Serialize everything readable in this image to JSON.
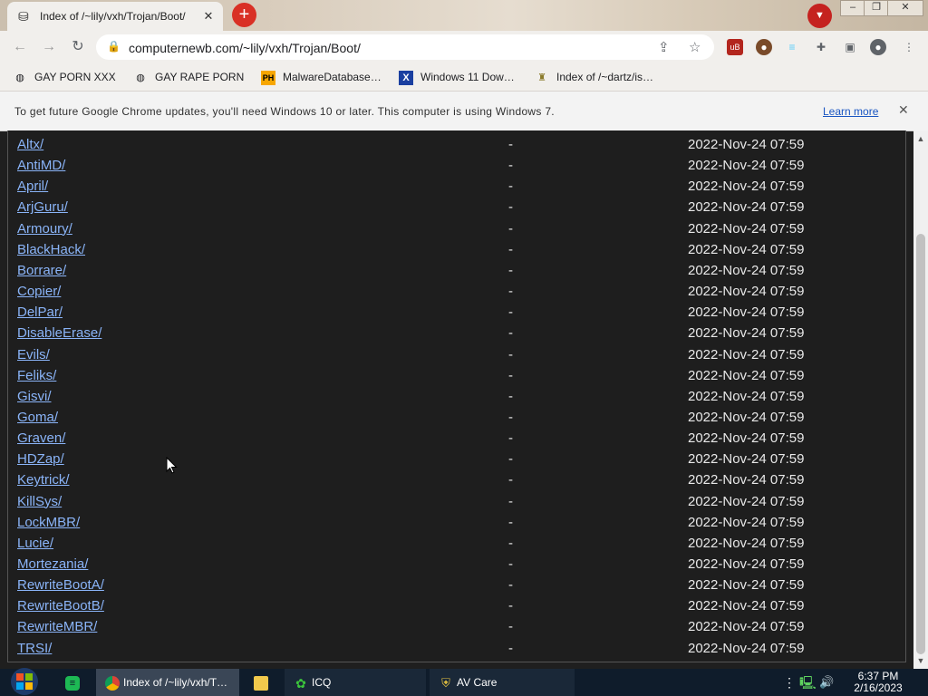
{
  "tab": {
    "title": "Index of /~lily/vxh/Trojan/Boot/"
  },
  "toolbar": {
    "url": "computernewb.com/~lily/vxh/Trojan/Boot/"
  },
  "bookmarks": [
    {
      "label": "GAY PORN XXX",
      "icon": "globe-icon"
    },
    {
      "label": "GAY RAPE PORN",
      "icon": "globe-icon"
    },
    {
      "label": "MalwareDatabase…",
      "icon": "ph-icon",
      "icon_text": "PH"
    },
    {
      "label": "Windows 11 Dow…",
      "icon": "x-icon",
      "icon_text": "X"
    },
    {
      "label": "Index of /~dartz/is…",
      "icon": "folder-icon"
    }
  ],
  "infobar": {
    "message": "To get future Google Chrome updates, you'll need Windows 10 or later. This computer is using Windows 7.",
    "link": "Learn more"
  },
  "listing": [
    {
      "name": "Altx/",
      "size": "-",
      "date": "2022-Nov-24 07:59"
    },
    {
      "name": "AntiMD/",
      "size": "-",
      "date": "2022-Nov-24 07:59"
    },
    {
      "name": "April/",
      "size": "-",
      "date": "2022-Nov-24 07:59"
    },
    {
      "name": "ArjGuru/",
      "size": "-",
      "date": "2022-Nov-24 07:59"
    },
    {
      "name": "Armoury/",
      "size": "-",
      "date": "2022-Nov-24 07:59"
    },
    {
      "name": "BlackHack/",
      "size": "-",
      "date": "2022-Nov-24 07:59"
    },
    {
      "name": "Borrare/",
      "size": "-",
      "date": "2022-Nov-24 07:59"
    },
    {
      "name": "Copier/",
      "size": "-",
      "date": "2022-Nov-24 07:59"
    },
    {
      "name": "DelPar/",
      "size": "-",
      "date": "2022-Nov-24 07:59"
    },
    {
      "name": "DisableErase/",
      "size": "-",
      "date": "2022-Nov-24 07:59"
    },
    {
      "name": "Evils/",
      "size": "-",
      "date": "2022-Nov-24 07:59"
    },
    {
      "name": "Feliks/",
      "size": "-",
      "date": "2022-Nov-24 07:59"
    },
    {
      "name": "Gisvi/",
      "size": "-",
      "date": "2022-Nov-24 07:59"
    },
    {
      "name": "Goma/",
      "size": "-",
      "date": "2022-Nov-24 07:59"
    },
    {
      "name": "Graven/",
      "size": "-",
      "date": "2022-Nov-24 07:59"
    },
    {
      "name": "HDZap/",
      "size": "-",
      "date": "2022-Nov-24 07:59"
    },
    {
      "name": "Keytrick/",
      "size": "-",
      "date": "2022-Nov-24 07:59"
    },
    {
      "name": "KillSys/",
      "size": "-",
      "date": "2022-Nov-24 07:59"
    },
    {
      "name": "LockMBR/",
      "size": "-",
      "date": "2022-Nov-24 07:59"
    },
    {
      "name": "Lucie/",
      "size": "-",
      "date": "2022-Nov-24 07:59"
    },
    {
      "name": "Mortezania/",
      "size": "-",
      "date": "2022-Nov-24 07:59"
    },
    {
      "name": "RewriteBootA/",
      "size": "-",
      "date": "2022-Nov-24 07:59"
    },
    {
      "name": "RewriteBootB/",
      "size": "-",
      "date": "2022-Nov-24 07:59"
    },
    {
      "name": "RewriteMBR/",
      "size": "-",
      "date": "2022-Nov-24 07:59"
    },
    {
      "name": "TRSI/",
      "size": "-",
      "date": "2022-Nov-24 07:59"
    }
  ],
  "taskbar": {
    "items": [
      {
        "label": "Index of /~lily/vxh/T…",
        "icon": "chrome-icon"
      },
      {
        "label": "",
        "icon": "folder-icon"
      },
      {
        "label": "ICQ",
        "icon": "icq-icon"
      },
      {
        "label": "AV Care",
        "icon": "shield-icon"
      }
    ],
    "time": "6:37 PM",
    "date": "2/16/2023"
  },
  "colors": {
    "link": "#8ab4f8",
    "page_bg": "#1e1e1e",
    "new_tab_button": "#d93025",
    "taskbar_bg": "#0f1c2b",
    "infobar_link": "#1a56c2"
  }
}
